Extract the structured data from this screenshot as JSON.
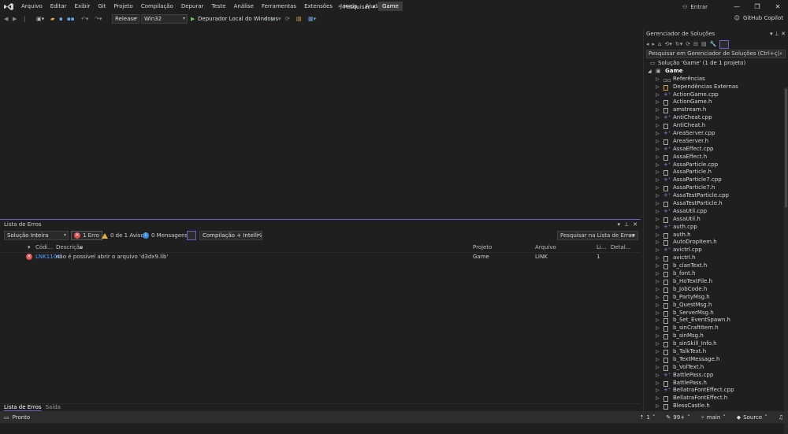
{
  "menubar": {
    "items": [
      "Arquivo",
      "Editar",
      "Exibir",
      "Git",
      "Projeto",
      "Compilação",
      "Depurar",
      "Teste",
      "Análise",
      "Ferramentas",
      "Extensões",
      "Janela",
      "Ajuda"
    ],
    "search_label": "Pesquisar",
    "solution_title": "Game",
    "signin_label": "Entrar",
    "copilot_label": "GitHub Copilot"
  },
  "toolbar": {
    "configuration": "Release",
    "platform": "Win32",
    "debugger_label": "Depurador Local do Windows"
  },
  "error_list": {
    "title": "Lista de Erros",
    "scope": "Solução Inteira",
    "errors_label": "1 Erro",
    "warnings_label": "0 de 1 Aviso",
    "messages_label": "0 Mensagens",
    "build_filter": "Compilação + IntelliSense",
    "search_placeholder": "Pesquisar na Lista de Erros",
    "columns": {
      "code": "Códi...",
      "description": "Descrição",
      "project": "Projeto",
      "file": "Arquivo",
      "line": "Li...",
      "details": "Detal..."
    },
    "rows": [
      {
        "code": "LNK1104",
        "description": "não é possível abrir o arquivo 'd3dx9.lib'",
        "project": "Game",
        "file": "LINK",
        "line": "1"
      }
    ],
    "tabs": [
      "Lista de Erros",
      "Saída"
    ]
  },
  "solution_explorer": {
    "title": "Gerenciador de Soluções",
    "search_placeholder": "Pesquisar em Gerenciador de Soluções (Ctrl+ç)",
    "solution_label": "Solução 'Game' (1 de 1 projeto)",
    "project_label": "Game",
    "items": [
      {
        "name": "Referências",
        "type": "ref"
      },
      {
        "name": "Dependências Externas",
        "type": "folder"
      },
      {
        "name": "ActionGame.cpp",
        "type": "cpp"
      },
      {
        "name": "ActionGame.h",
        "type": "h"
      },
      {
        "name": "amstream.h",
        "type": "h"
      },
      {
        "name": "AntiCheat.cpp",
        "type": "cpp"
      },
      {
        "name": "AntiCheat.h",
        "type": "h"
      },
      {
        "name": "AreaServer.cpp",
        "type": "cpp"
      },
      {
        "name": "AreaServer.h",
        "type": "h"
      },
      {
        "name": "AssaEffect.cpp",
        "type": "cpp"
      },
      {
        "name": "AssaEffect.h",
        "type": "h"
      },
      {
        "name": "AssaParticle.cpp",
        "type": "cpp"
      },
      {
        "name": "AssaParticle.h",
        "type": "h"
      },
      {
        "name": "AssaParticle7.cpp",
        "type": "cpp"
      },
      {
        "name": "AssaParticle7.h",
        "type": "h"
      },
      {
        "name": "AssaTestParticle.cpp",
        "type": "cpp"
      },
      {
        "name": "AssaTestParticle.h",
        "type": "h"
      },
      {
        "name": "AssaUtil.cpp",
        "type": "cpp"
      },
      {
        "name": "AssaUtil.h",
        "type": "h"
      },
      {
        "name": "auth.cpp",
        "type": "cpp"
      },
      {
        "name": "auth.h",
        "type": "h"
      },
      {
        "name": "AutoDropItem.h",
        "type": "h"
      },
      {
        "name": "avictrl.cpp",
        "type": "cpp"
      },
      {
        "name": "avictrl.h",
        "type": "h"
      },
      {
        "name": "b_clanText.h",
        "type": "h"
      },
      {
        "name": "b_font.h",
        "type": "h"
      },
      {
        "name": "b_HoTextFile.h",
        "type": "h"
      },
      {
        "name": "b_JobCode.h",
        "type": "h"
      },
      {
        "name": "b_PartyMsg.h",
        "type": "h"
      },
      {
        "name": "b_QuestMsg.h",
        "type": "h"
      },
      {
        "name": "b_ServerMsg.h",
        "type": "h"
      },
      {
        "name": "b_Set_EventSpawn.h",
        "type": "h"
      },
      {
        "name": "b_sinCraftItem.h",
        "type": "h"
      },
      {
        "name": "b_sinMsg.h",
        "type": "h"
      },
      {
        "name": "b_sinSkill_Info.h",
        "type": "h"
      },
      {
        "name": "b_TalkText.h",
        "type": "h"
      },
      {
        "name": "b_TextMessage.h",
        "type": "h"
      },
      {
        "name": "b_VolText.h",
        "type": "h"
      },
      {
        "name": "BattlePass.cpp",
        "type": "cpp"
      },
      {
        "name": "BattlePass.h",
        "type": "h"
      },
      {
        "name": "BellatraFontEffect.cpp",
        "type": "cpp"
      },
      {
        "name": "BellatraFontEffect.h",
        "type": "h"
      },
      {
        "name": "BlessCastle.h",
        "type": "h"
      }
    ]
  },
  "statusbar": {
    "ready": "Pronto",
    "up_count": "1",
    "pencil_count": "99+",
    "branch": "main",
    "source_control": "Source"
  }
}
